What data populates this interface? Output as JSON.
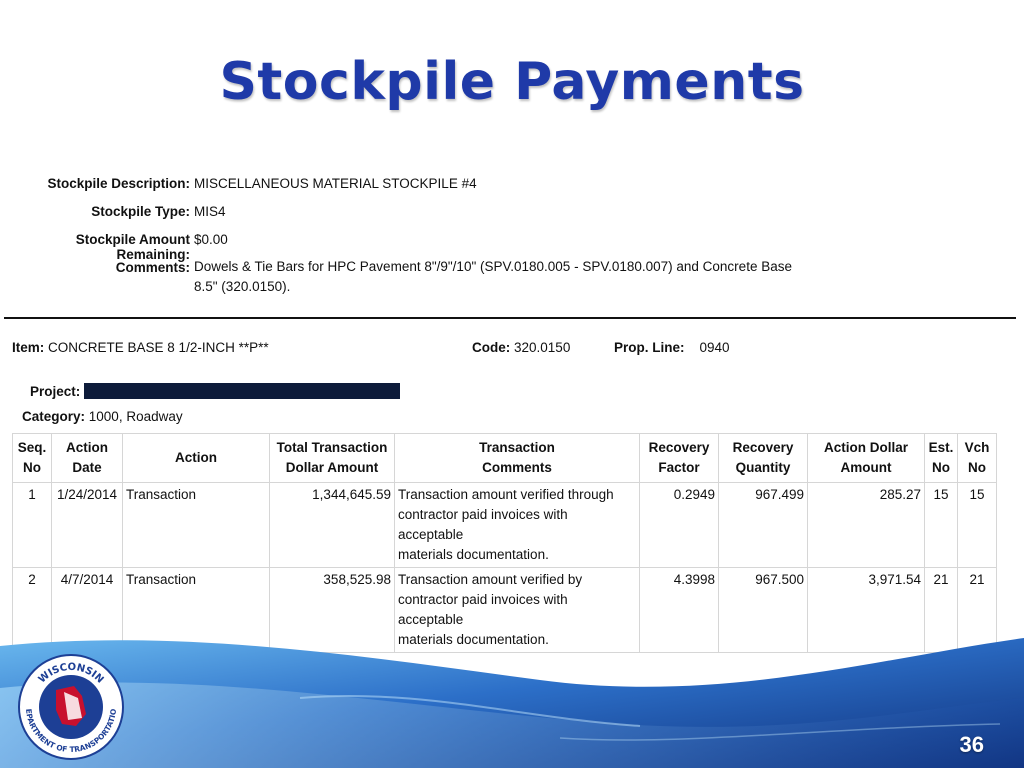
{
  "slide": {
    "title": "Stockpile Payments",
    "page_number": "36"
  },
  "stockpile": {
    "description_label": "Stockpile Description:",
    "description": "MISCELLANEOUS MATERIAL STOCKPILE #4",
    "type_label": "Stockpile Type:",
    "type": "MIS4",
    "remaining_label": "Stockpile Amount Remaining:",
    "remaining": "$0.00",
    "comments_label": "Comments:",
    "comments_line1": "Dowels & Tie Bars for HPC Pavement 8\"/9\"/10\" (SPV.0180.005 - SPV.0180.007) and Concrete Base",
    "comments_line2": "8.5\" (320.0150)."
  },
  "item": {
    "item_label": "Item:",
    "item_value": "CONCRETE BASE 8 1/2-INCH **P**",
    "code_label": "Code:",
    "code_value": "320.0150",
    "prop_label": "Prop. Line:",
    "prop_value": "0940",
    "project_label": "Project:",
    "category_label": "Category:",
    "category_value": "1000, Roadway"
  },
  "table": {
    "headers": [
      [
        "Seq.",
        "No"
      ],
      [
        "Action",
        "Date"
      ],
      [
        "Action",
        ""
      ],
      [
        "Total Transaction",
        "Dollar Amount"
      ],
      [
        "Transaction",
        "Comments"
      ],
      [
        "Recovery",
        "Factor"
      ],
      [
        "Recovery",
        "Quantity"
      ],
      [
        "Action Dollar",
        "Amount"
      ],
      [
        "Est.",
        "No"
      ],
      [
        "Vch",
        "No"
      ]
    ],
    "rows": [
      {
        "seq": "1",
        "date": "1/24/2014",
        "action": "Transaction",
        "total": "1,344,645.59",
        "comments": [
          "Transaction amount verified through",
          "contractor paid invoices with acceptable",
          "materials documentation."
        ],
        "factor": "0.2949",
        "quantity": "967.499",
        "amount": "285.27",
        "est": "15",
        "vch": "15"
      },
      {
        "seq": "2",
        "date": "4/7/2014",
        "action": "Transaction",
        "total": "358,525.98",
        "comments": [
          "Transaction amount verified by",
          "contractor paid invoices with acceptable",
          "materials documentation."
        ],
        "factor": "4.3998",
        "quantity": "967.500",
        "amount": "3,971.54",
        "est": "21",
        "vch": "21"
      }
    ]
  },
  "logo": {
    "top_text": "WISCONSIN",
    "ring_text": "DEPARTMENT OF TRANSPORTATION"
  },
  "colors": {
    "title": "#1f3aa8",
    "banner_dark": "#0f2f7a",
    "banner_light": "#5fb0e8",
    "redaction": "#0d1b3a"
  }
}
